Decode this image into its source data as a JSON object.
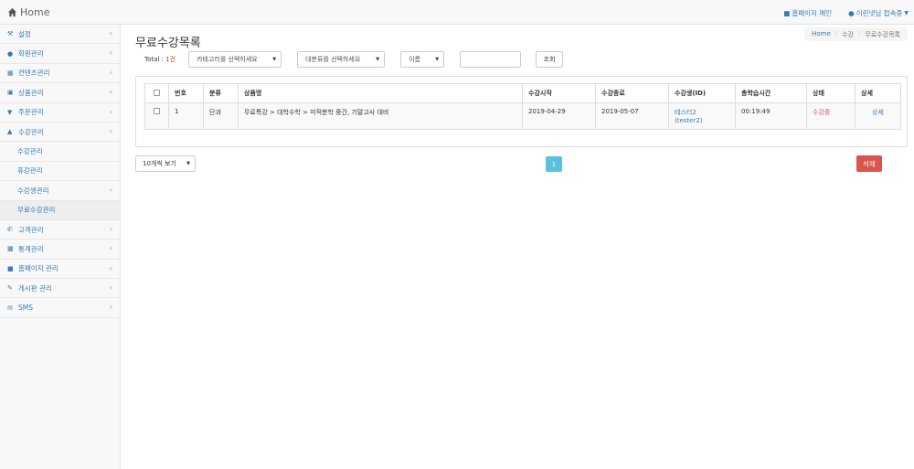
{
  "topbar": {
    "brand": "Home",
    "home_link": "홈페이지 메인",
    "user_menu": "이린넷님 접속중"
  },
  "sidebar": {
    "items": [
      {
        "label": "설정",
        "icon": "wrench-icon"
      },
      {
        "label": "회원관리",
        "icon": "user-icon"
      },
      {
        "label": "컨텐츠관리",
        "icon": "film-icon"
      },
      {
        "label": "상품관리",
        "icon": "gift-icon"
      },
      {
        "label": "주문관리",
        "icon": "cart-icon"
      },
      {
        "label": "수강관리",
        "icon": "graduation-cap-icon"
      },
      {
        "label": "수강관리"
      },
      {
        "label": "휴강관리"
      },
      {
        "label": "수강생관리"
      },
      {
        "label": "무료수강관리"
      },
      {
        "label": "고객관리",
        "icon": "phone-icon"
      },
      {
        "label": "통계관리",
        "icon": "bar-chart-icon"
      },
      {
        "label": "홈페이지 관리",
        "icon": "car-icon"
      },
      {
        "label": "게시판 관리",
        "icon": "edit-icon"
      },
      {
        "label": "SMS",
        "icon": "envelope-icon"
      }
    ]
  },
  "main": {
    "title": "무료수강목록",
    "breadcrumb": [
      "Home",
      "수강",
      "무료수강목록"
    ],
    "filter": {
      "total_label": "Total : ",
      "total_count": "1건",
      "category_select": "카테고리를 선택하세요",
      "major_select": "대분류를 선택하세요",
      "name_select": "이름",
      "search_value": "",
      "search_button": "조회"
    },
    "table": {
      "headers": [
        "번호",
        "분류",
        "상품명",
        "수강시작",
        "수강종료",
        "수강생(ID)",
        "총학습시간",
        "상태",
        "상세"
      ],
      "rows": [
        {
          "no": "1",
          "category": "단과",
          "product": "무료특강 > 대학수학 > 미적분학 중간, 기말고사 대비",
          "start": "2019-04-29",
          "end": "2019-05-07",
          "student_name": "테스터2",
          "student_id": "(tester2)",
          "total_time": "00:19:49",
          "status": "수강중",
          "detail": "상세"
        }
      ]
    },
    "page_size": "10개씩 보기",
    "current_page": "1",
    "delete_button": "삭제"
  },
  "colors": {
    "link": "#337ab7",
    "danger": "#d9534f",
    "pager": "#5bc0de"
  }
}
